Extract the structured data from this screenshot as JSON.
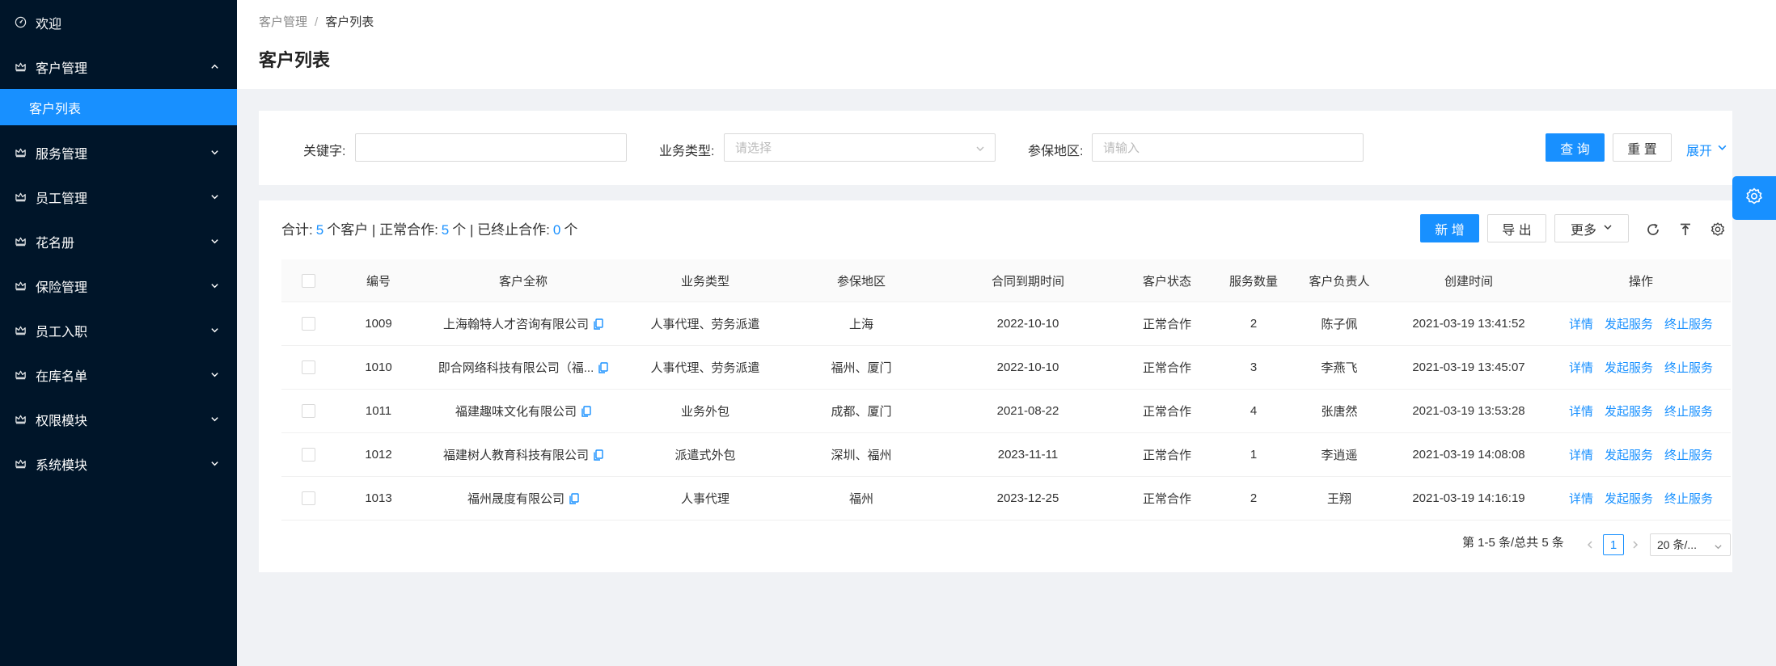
{
  "sidebar": {
    "items": [
      {
        "label": "欢迎",
        "icon": "dashboard-icon"
      },
      {
        "label": "客户管理",
        "icon": "crown-icon",
        "expanded": true
      },
      {
        "label": "服务管理",
        "icon": "crown-icon"
      },
      {
        "label": "员工管理",
        "icon": "crown-icon"
      },
      {
        "label": "花名册",
        "icon": "crown-icon"
      },
      {
        "label": "保险管理",
        "icon": "crown-icon"
      },
      {
        "label": "员工入职",
        "icon": "crown-icon"
      },
      {
        "label": "在库名单",
        "icon": "crown-icon"
      },
      {
        "label": "权限模块",
        "icon": "crown-icon"
      },
      {
        "label": "系统模块",
        "icon": "crown-icon"
      }
    ],
    "active_sub": "客户列表"
  },
  "header": {
    "breadcrumb": [
      "客户管理",
      "客户列表"
    ],
    "title": "客户列表"
  },
  "search": {
    "keyword_label": "关键字:",
    "keyword_value": "",
    "biz_type_label": "业务类型:",
    "biz_type_placeholder": "请选择",
    "region_label": "参保地区:",
    "region_placeholder": "请输入",
    "query_btn": "查 询",
    "reset_btn": "重 置",
    "expand_link": "展开"
  },
  "summary": {
    "total_label": "合计:",
    "total_count": "5",
    "total_unit": "个客户 | 正常合作:",
    "normal_count": "5",
    "normal_unit": "个 | 已终止合作:",
    "ended_count": "0",
    "ended_unit": "个"
  },
  "toolbar": {
    "new_btn": "新 增",
    "export_btn": "导 出",
    "more_btn": "更多"
  },
  "table": {
    "columns": [
      "编号",
      "客户全称",
      "业务类型",
      "参保地区",
      "合同到期时间",
      "客户状态",
      "服务数量",
      "客户负责人",
      "创建时间",
      "操作"
    ],
    "rows": [
      {
        "id": "1009",
        "name": "上海翰特人才咨询有限公司",
        "biz": "人事代理、劳务派遣",
        "region": "上海",
        "expire": "2022-10-10",
        "status": "正常合作",
        "count": "2",
        "owner": "陈子佩",
        "created": "2021-03-19 13:41:52"
      },
      {
        "id": "1010",
        "name": "即合网络科技有限公司（福...",
        "biz": "人事代理、劳务派遣",
        "region": "福州、厦门",
        "expire": "2022-10-10",
        "status": "正常合作",
        "count": "3",
        "owner": "李燕飞",
        "created": "2021-03-19 13:45:07"
      },
      {
        "id": "1011",
        "name": "福建趣味文化有限公司",
        "biz": "业务外包",
        "region": "成都、厦门",
        "expire": "2021-08-22",
        "status": "正常合作",
        "count": "4",
        "owner": "张唐然",
        "created": "2021-03-19 13:53:28"
      },
      {
        "id": "1012",
        "name": "福建树人教育科技有限公司",
        "biz": "派遣式外包",
        "region": "深圳、福州",
        "expire": "2023-11-11",
        "status": "正常合作",
        "count": "1",
        "owner": "李逍遥",
        "created": "2021-03-19 14:08:08"
      },
      {
        "id": "1013",
        "name": "福州晟度有限公司",
        "biz": "人事代理",
        "region": "福州",
        "expire": "2023-12-25",
        "status": "正常合作",
        "count": "2",
        "owner": "王翔",
        "created": "2021-03-19 14:16:19"
      }
    ],
    "actions": [
      "详情",
      "发起服务",
      "终止服务"
    ]
  },
  "pagination": {
    "range_text": "第 1-5 条/总共 5 条",
    "current_page": "1",
    "page_size": "20 条/..."
  },
  "colors": {
    "primary": "#1890ff",
    "sidebar_bg": "#001529"
  }
}
